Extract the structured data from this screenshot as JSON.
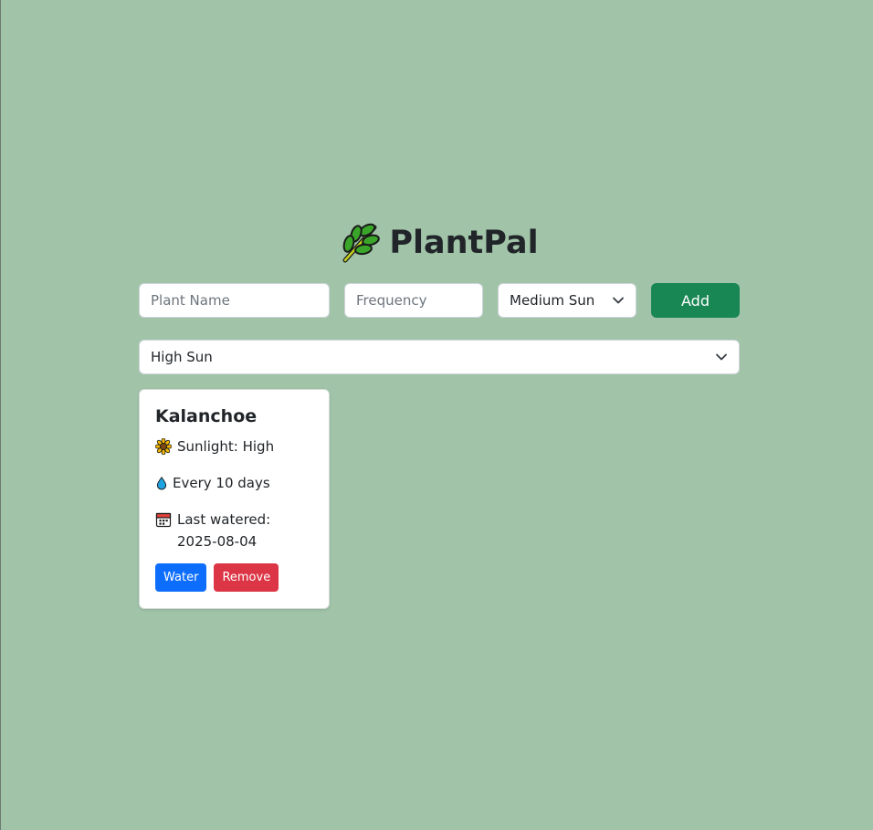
{
  "app": {
    "title": "PlantPal",
    "title_icon": "herb-leaf-icon"
  },
  "form": {
    "name_placeholder": "Plant Name",
    "frequency_placeholder": "Frequency",
    "sunlight_selected": "Medium Sun",
    "add_label": "Add"
  },
  "filter": {
    "selected": "High Sun"
  },
  "plants": [
    {
      "name": "Kalanchoe",
      "sunlight_text": "Sunlight: High",
      "frequency_text": "Every 10 days",
      "last_watered_text": "Last watered: 2025-08-04",
      "water_label": "Water",
      "remove_label": "Remove"
    }
  ],
  "colors": {
    "background": "#a1c4a9",
    "add_button": "#198754",
    "water_button": "#0d6efd",
    "remove_button": "#dc3545"
  }
}
